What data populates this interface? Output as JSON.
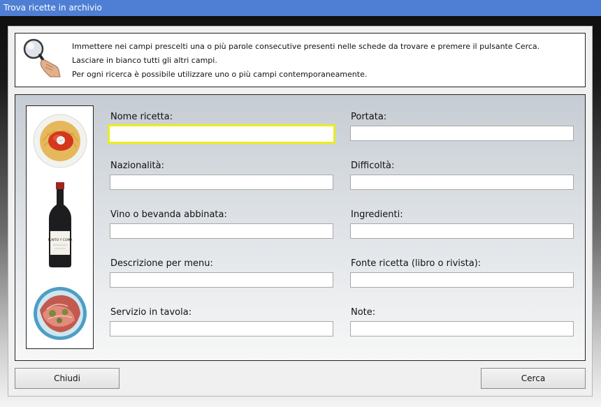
{
  "window": {
    "title": "Trova ricette in archivio"
  },
  "info": {
    "lines": [
      "Immettere nei campi prescelti una o più parole consecutive presenti nelle schede da trovare e premere il pulsante Cerca.",
      "Lasciare in bianco tutti gli altri campi.",
      "Per ogni ricerca è possibile utilizzare uno o più campi contemporaneamente."
    ]
  },
  "fields": {
    "nome_ricetta": {
      "label": "Nome ricetta:",
      "value": ""
    },
    "portata": {
      "label": "Portata:",
      "value": ""
    },
    "nazionalita": {
      "label": "Nazionalità:",
      "value": ""
    },
    "difficolta": {
      "label": "Difficoltà:",
      "value": ""
    },
    "vino": {
      "label": "Vino o bevanda abbinata:",
      "value": ""
    },
    "ingredienti": {
      "label": "Ingredienti:",
      "value": ""
    },
    "descrizione": {
      "label": "Descrizione per menu:",
      "value": ""
    },
    "fonte": {
      "label": "Fonte ricetta (libro o rivista):",
      "value": ""
    },
    "servizio": {
      "label": "Servizio in tavola:",
      "value": ""
    },
    "note": {
      "label": "Note:",
      "value": ""
    }
  },
  "buttons": {
    "close": "Chiudi",
    "search": "Cerca"
  },
  "bottle_label": "PUNTO Y COMA",
  "colors": {
    "titlebar": "#4f7fd4",
    "focus_border": "#ecec1e"
  }
}
